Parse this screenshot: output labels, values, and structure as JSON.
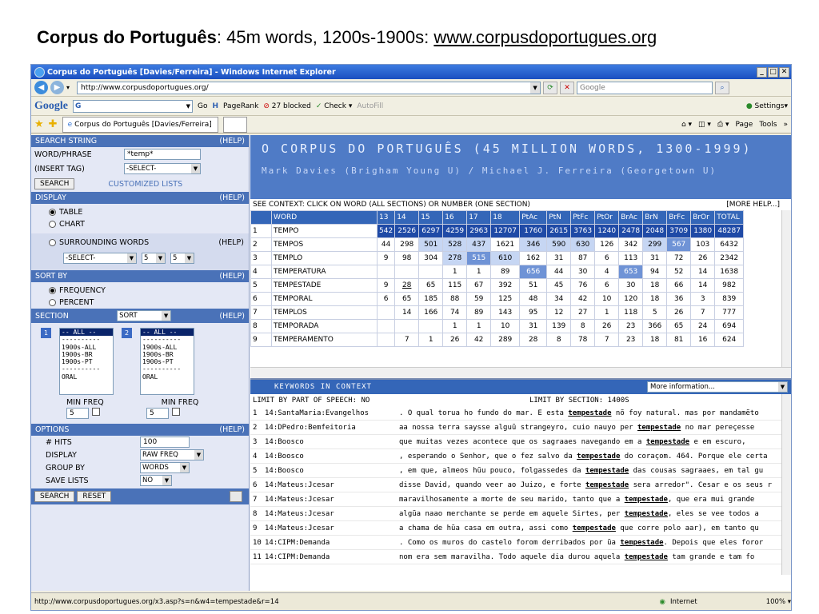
{
  "slide": {
    "title_bold": "Corpus do Português",
    "title_rest": ": 45m words, 1200s-1900s: ",
    "title_url": "www.corpusdoportugues.org"
  },
  "browser": {
    "window_title": "Corpus do Português [Davies/Ferreira] - Windows Internet Explorer",
    "address": "http://www.corpusdoportugues.org/",
    "search_placeholder": "Google",
    "google_label": "Google",
    "google_g": "G",
    "go_label": "Go",
    "pagerank_label": "PageRank",
    "blocked_label": "27 blocked",
    "check_label": "Check",
    "autofill_label": "AutoFill",
    "settings_label": "Settings",
    "tab_title": "Corpus do Português [Davies/Ferreira]",
    "page_menu": "Page",
    "tools_menu": "Tools",
    "status_url": "http://www.corpusdoportugues.org/x3.asp?s=n&w4=tempestade&r=14",
    "zone_label": "Internet",
    "zoom_label": "100%"
  },
  "left_panel": {
    "search_string_label": "SEARCH STRING",
    "help": "(HELP)",
    "word_phrase_label": "WORD/PHRASE",
    "word_phrase_value": "*temp*",
    "insert_tag_label": "(INSERT TAG)",
    "insert_tag_value": "-SELECT-",
    "search_button": "SEARCH",
    "customized_lists": "CUSTOMIZED LISTS",
    "display_label": "DISPLAY",
    "table_option": "TABLE",
    "chart_option": "CHART",
    "surrounding_option": "SURROUNDING WORDS",
    "surrounding_select": "-SELECT-",
    "span_left": "5",
    "span_right": "5",
    "sort_by_label": "SORT BY",
    "frequency_option": "FREQUENCY",
    "percent_option": "PERCENT",
    "section_label": "SECTION",
    "section_sort": "SORT",
    "list1_badge": "1",
    "list2_badge": "2",
    "list1_items": [
      "-- ALL --",
      "----------",
      "1900s-ALL",
      "1900s-BR",
      "1900s-PT",
      "----------",
      "ORAL"
    ],
    "list2_items": [
      "-- ALL --",
      "----------",
      "1900s-ALL",
      "1900s-BR",
      "1900s-PT",
      "----------",
      "ORAL"
    ],
    "min_freq_label": "MIN FREQ",
    "min_freq_1": "5",
    "min_freq_2": "5",
    "options_label": "OPTIONS",
    "hits_label": "# HITS",
    "hits_value": "100",
    "display_opt_label": "DISPLAY",
    "display_opt_value": "RAW FREQ",
    "group_by_label": "GROUP BY",
    "group_by_value": "WORDS",
    "save_lists_label": "SAVE LISTS",
    "save_lists_value": "NO",
    "search_btn2": "SEARCH",
    "reset_btn": "RESET"
  },
  "banner": {
    "title": "O CORPUS DO PORTUGUÊS (45 MILLION WORDS, 1300-1999)",
    "authors": "Mark Davies (Brigham Young U) / Michael J. Ferreira (Georgetown U)"
  },
  "freq": {
    "context_hint": "SEE CONTEXT: CLICK ON WORD (ALL SECTIONS) OR NUMBER (ONE SECTION)",
    "more_help": "[MORE HELP...]",
    "headers": [
      "",
      "WORD",
      "13",
      "14",
      "15",
      "16",
      "17",
      "18",
      "PtAc",
      "PtN",
      "PtFc",
      "PtOr",
      "BrAc",
      "BrN",
      "BrFc",
      "BrOr",
      "TOTAL"
    ],
    "rows": [
      [
        "1",
        "TEMPO",
        "542",
        "2526",
        "6297",
        "4259",
        "2963",
        "12707",
        "1760",
        "2615",
        "3763",
        "1240",
        "2478",
        "2048",
        "3709",
        "1380",
        "48287"
      ],
      [
        "2",
        "TEMPOS",
        "44",
        "298",
        "501",
        "528",
        "437",
        "1621",
        "346",
        "590",
        "630",
        "126",
        "342",
        "299",
        "567",
        "103",
        "6432"
      ],
      [
        "3",
        "TEMPLO",
        "9",
        "98",
        "304",
        "278",
        "515",
        "610",
        "162",
        "31",
        "87",
        "6",
        "113",
        "31",
        "72",
        "26",
        "2342"
      ],
      [
        "4",
        "TEMPERATURA",
        "",
        "",
        "",
        "1",
        "1",
        "89",
        "656",
        "44",
        "30",
        "4",
        "653",
        "94",
        "52",
        "14",
        "1638"
      ],
      [
        "5",
        "TEMPESTADE",
        "9",
        "28",
        "65",
        "115",
        "67",
        "392",
        "51",
        "45",
        "76",
        "6",
        "30",
        "18",
        "66",
        "14",
        "982"
      ],
      [
        "6",
        "TEMPORAL",
        "6",
        "65",
        "185",
        "88",
        "59",
        "125",
        "48",
        "34",
        "42",
        "10",
        "120",
        "18",
        "36",
        "3",
        "839"
      ],
      [
        "7",
        "TEMPLOS",
        "",
        "14",
        "166",
        "74",
        "89",
        "143",
        "95",
        "12",
        "27",
        "1",
        "118",
        "5",
        "26",
        "7",
        "777"
      ],
      [
        "8",
        "TEMPORADA",
        "",
        "",
        "",
        "1",
        "1",
        "10",
        "31",
        "139",
        "8",
        "26",
        "23",
        "366",
        "65",
        "24",
        "694"
      ],
      [
        "9",
        "TEMPERAMENTO",
        "",
        "7",
        "1",
        "26",
        "42",
        "289",
        "28",
        "8",
        "78",
        "7",
        "23",
        "18",
        "81",
        "16",
        "624"
      ]
    ]
  },
  "kwic": {
    "header": "KEYWORDS IN CONTEXT",
    "more_info": "More information...",
    "limit_pos": "LIMIT BY PART OF SPEECH: NO",
    "limit_section": "LIMIT BY SECTION:  1400S",
    "rows": [
      {
        "n": "1",
        "src": "14:SantaMaria:Evangelhos",
        "pre": ". O qual torua ho fundo do mar. E esta ",
        "kw": "tempestade",
        "post": " nõ foy natural. mas por mandamẽto"
      },
      {
        "n": "2",
        "src": "14:DPedro:Bemfeitoria",
        "pre": "aa nossa terra saysse alguũ strangeyro, cuio nauyo per ",
        "kw": "tempestade",
        "post": " no mar pereçesse"
      },
      {
        "n": "3",
        "src": "14:Boosco",
        "pre": "que muitas vezes acontece que os sagraaes navegando em a ",
        "kw": "tempestade",
        "post": " e em escuro,"
      },
      {
        "n": "4",
        "src": "14:Boosco",
        "pre": ", esperando o Senhor, que o fez salvo da ",
        "kw": "tempestade",
        "post": " do coraçom. 464. Porque ele certa"
      },
      {
        "n": "5",
        "src": "14:Boosco",
        "pre": ", em que, almeos hũu pouco, folgassedes da ",
        "kw": "tempestade",
        "post": " das cousas sagraaes, em tal gu"
      },
      {
        "n": "6",
        "src": "14:Mateus:Jcesar",
        "pre": "disse David, quando veer ao Juizo, e forte ",
        "kw": "tempestade",
        "post": " sera arredor\". Cesar e os seus r"
      },
      {
        "n": "7",
        "src": "14:Mateus:Jcesar",
        "pre": "maravilhosamente a morte de seu marido, tanto que a ",
        "kw": "tempestade",
        "post": ", que era mui grande"
      },
      {
        "n": "8",
        "src": "14:Mateus:Jcesar",
        "pre": "algũa naao merchante se perde em aquele Sirtes, per ",
        "kw": "tempestade",
        "post": ", eles se vee todos a"
      },
      {
        "n": "9",
        "src": "14:Mateus:Jcesar",
        "pre": "a chama de hũa casa em outra, assi como ",
        "kw": "tempestade",
        "post": " que corre polo aar), em tanto qu"
      },
      {
        "n": "10",
        "src": "14:CIPM:Demanda",
        "pre": ". Como os muros do castelo forom derribados por ũa ",
        "kw": "tempestade",
        "post": ". Depois que eles foror"
      },
      {
        "n": "11",
        "src": "14:CIPM:Demanda",
        "pre": "nom era sem maravilha. Todo aquele dia durou aquela ",
        "kw": "tempestade",
        "post": " tam grande e tam fo"
      }
    ]
  },
  "colors": {
    "header_blue": "#3466b8",
    "banner_blue": "#4f7bc6",
    "shade_dark": "#1f4aa6",
    "shade_mid": "#6f93d6",
    "shade_light": "#c6d6f3"
  }
}
